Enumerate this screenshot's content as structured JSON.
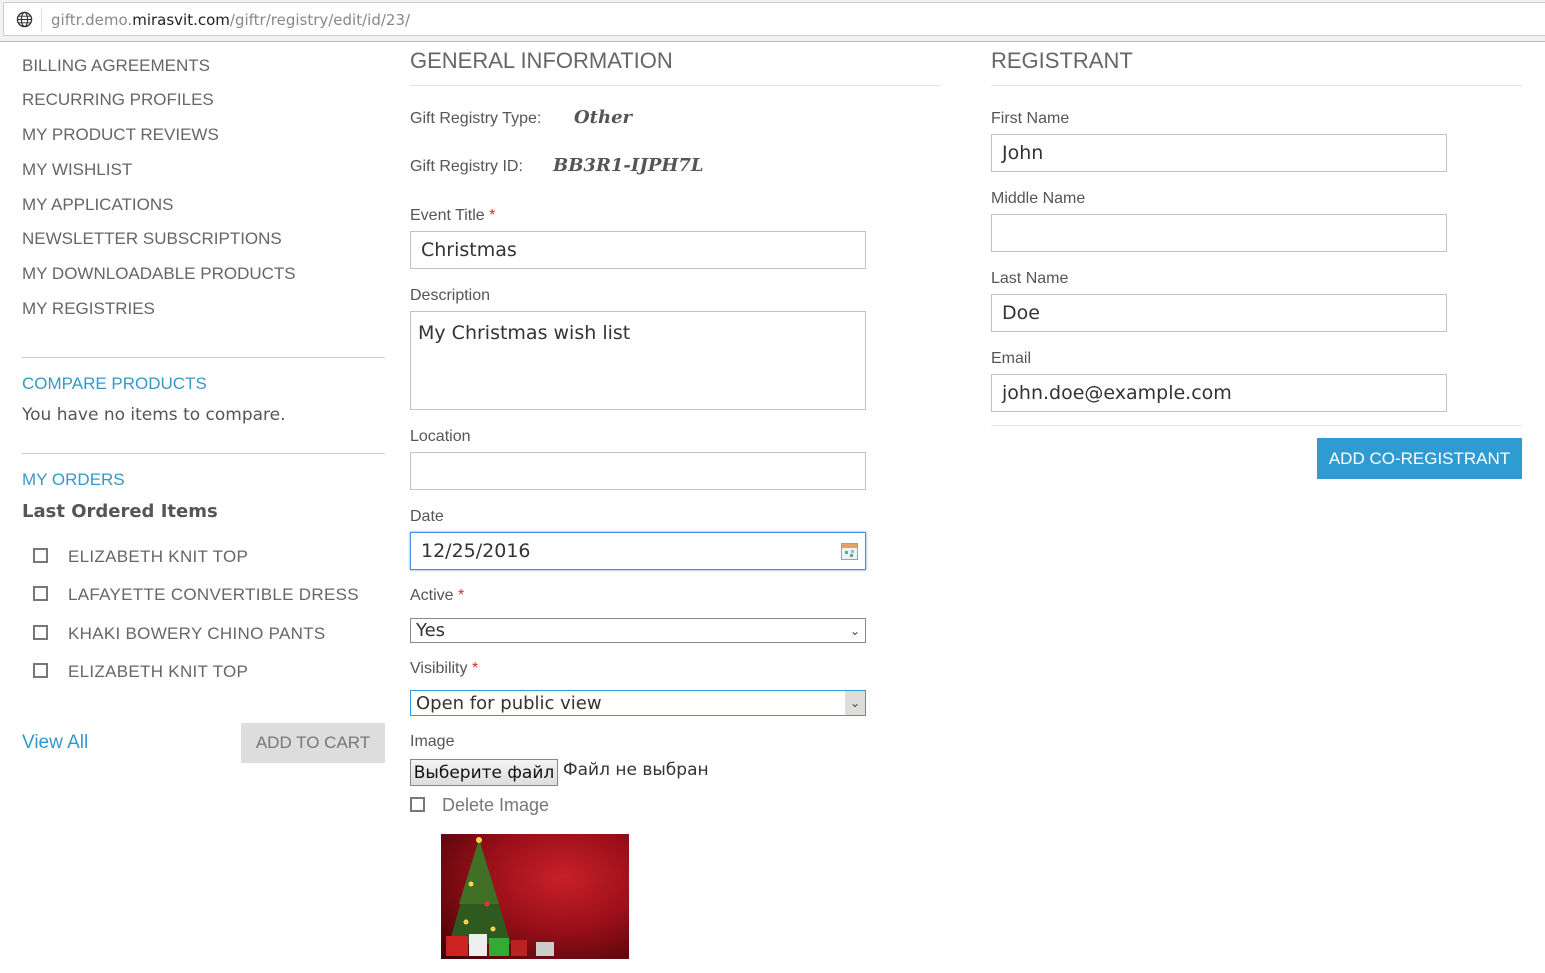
{
  "browser": {
    "url_domain_prefix": "giftr.demo.",
    "url_domain": "mirasvit.com",
    "url_path": "/giftr/registry/edit/id/23/"
  },
  "sidebar": {
    "nav": [
      "BILLING AGREEMENTS",
      "RECURRING PROFILES",
      "MY PRODUCT REVIEWS",
      "MY WISHLIST",
      "MY APPLICATIONS",
      "NEWSLETTER SUBSCRIPTIONS",
      "MY DOWNLOADABLE PRODUCTS",
      "MY REGISTRIES"
    ],
    "compare": {
      "title": "COMPARE PRODUCTS",
      "empty": "You have no items to compare."
    },
    "orders": {
      "title": "MY ORDERS",
      "subtitle": "Last Ordered Items",
      "items": [
        "ELIZABETH KNIT TOP",
        "LAFAYETTE CONVERTIBLE DRESS",
        "KHAKI BOWERY CHINO PANTS",
        "ELIZABETH KNIT TOP"
      ],
      "view_all": "View All",
      "add_to_cart": "ADD TO CART"
    }
  },
  "general": {
    "title": "GENERAL INFORMATION",
    "type_label": "Gift Registry Type:",
    "type_value": "Other",
    "id_label": "Gift Registry ID:",
    "id_value": "BB3R1-IJPH7L",
    "event_title_label": "Event Title",
    "event_title": "Christmas",
    "description_label": "Description",
    "description": "My Christmas wish list",
    "location_label": "Location",
    "location": "",
    "date_label": "Date",
    "date": "12/25/2016",
    "active_label": "Active",
    "active": "Yes",
    "visibility_label": "Visibility",
    "visibility": "Open for public view",
    "image_label": "Image",
    "choose_file": "Выберите файл",
    "no_file": "Файл не выбран",
    "delete_image": "Delete Image",
    "required": "*"
  },
  "registrant": {
    "title": "REGISTRANT",
    "first_name_label": "First Name",
    "first_name": "John",
    "middle_name_label": "Middle Name",
    "middle_name": "",
    "last_name_label": "Last Name",
    "last_name": "Doe",
    "email_label": "Email",
    "email": "john.doe@example.com",
    "add_button": "ADD CO-REGISTRANT"
  },
  "colors": {
    "accent": "#3399cc",
    "button": "#2f9bd3",
    "required": "#e02b27"
  }
}
